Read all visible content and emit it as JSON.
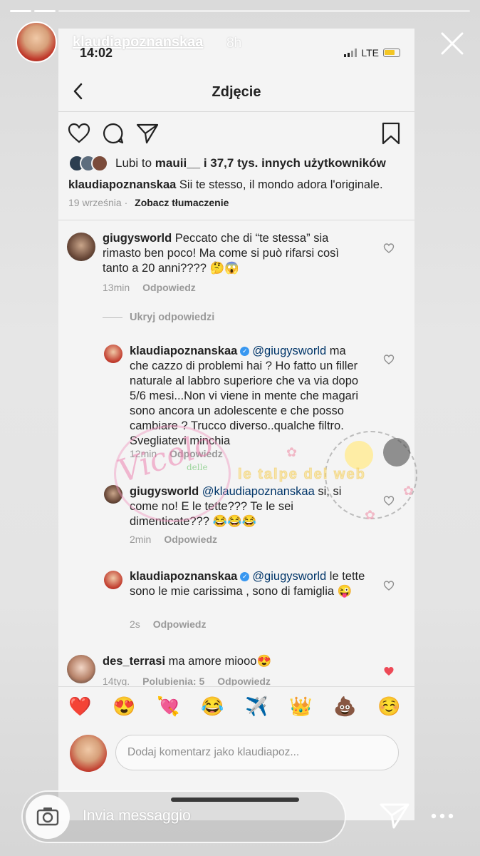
{
  "story": {
    "username": "klaudiapoznanskaa",
    "time_ago": "8h",
    "reply_placeholder": "Invia messaggio"
  },
  "status_bar": {
    "time": "14:02",
    "network": "LTE"
  },
  "nav": {
    "title": "Zdjęcie"
  },
  "post": {
    "likes_prefix": "Lubi to",
    "likes_user": "mauii__",
    "likes_rest": "i 37,7 tys. innych użytkowników",
    "caption_user": "klaudiapoznanskaa",
    "caption_text": "Sii te stesso, il mondo adora l'originale.",
    "date": "19 września",
    "translate": "Zobacz tłumaczenie"
  },
  "comments": [
    {
      "user": "giugysworld",
      "text": "Peccato che di “te stessa” sia rimasto ben poco! Ma come si può rifarsi così tanto a 20 anni???? 🤔😱",
      "time": "13min",
      "reply": "Odpowiedz"
    }
  ],
  "hide_replies": "Ukryj odpowiedzi",
  "replies": [
    {
      "user": "klaudiapoznanskaa",
      "mention": "@giugysworld",
      "text": "ma che cazzo di problemi hai ? Ho fatto un filler naturale al labbro superiore che va via dopo 5/6 mesi...Non vi viene in mente che magari sono ancora un adolescente e che posso cambiare ? Trucco diverso..qualche filtro. Svegliatevi minchia",
      "time": "12min",
      "reply": "Odpowiedz"
    },
    {
      "user": "giugysworld",
      "mention": "@klaudiapoznanskaa",
      "text": "si, si come no! E le tette??? Te le sei dimenticate??? 😂😂😂",
      "time": "2min",
      "reply": "Odpowiedz"
    },
    {
      "user": "klaudiapoznanskaa",
      "mention": "@giugysworld",
      "text": "le tette sono le mie carissima , sono di famiglia 😜",
      "time": "2s",
      "reply": "Odpowiedz"
    }
  ],
  "last_comment": {
    "user": "des_terrasi",
    "text": "ma amore miooo😍",
    "time": "14tyg.",
    "likes": "Polubienia: 5",
    "reply": "Odpowiedz"
  },
  "emoji_bar": [
    "❤️",
    "😍",
    "💘",
    "😂",
    "✈️",
    "👑",
    "💩",
    "☺️"
  ],
  "compose": {
    "placeholder": "Dodaj komentarz jako klaudiapoz..."
  },
  "watermark": {
    "script": "Vicolo",
    "small": "delle",
    "banner": "le talpe del web"
  },
  "colors": {
    "verified": "#3897f0",
    "liked_heart": "#ed4956",
    "text": "#222222",
    "meta": "#999999"
  }
}
